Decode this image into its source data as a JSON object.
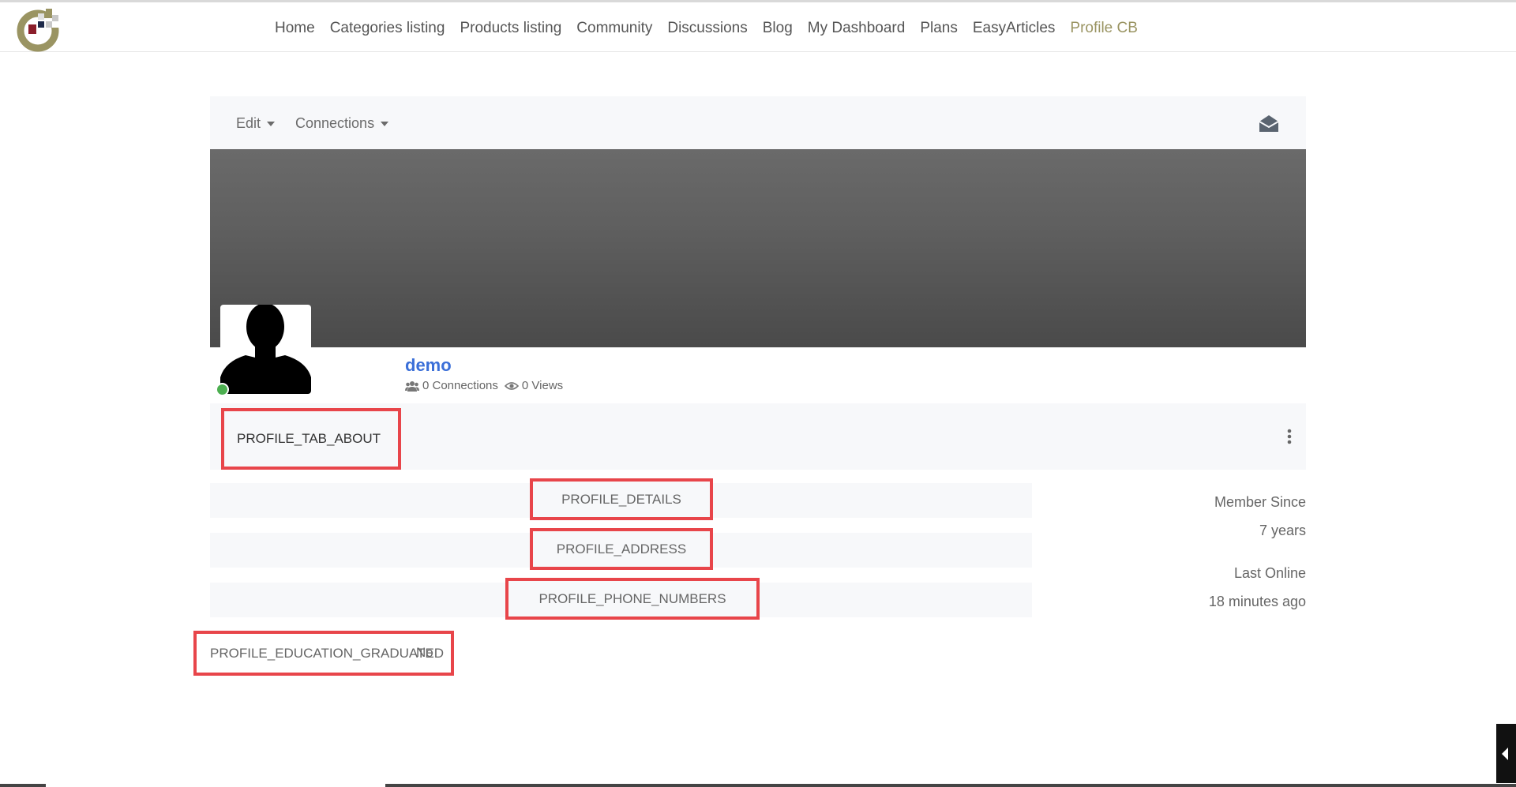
{
  "nav": {
    "items": [
      {
        "label": "Home"
      },
      {
        "label": "Categories listing"
      },
      {
        "label": "Products listing"
      },
      {
        "label": "Community"
      },
      {
        "label": "Discussions"
      },
      {
        "label": "Blog"
      },
      {
        "label": "My Dashboard"
      },
      {
        "label": "Plans"
      },
      {
        "label": "EasyArticles"
      },
      {
        "label": "Profile CB"
      }
    ],
    "active": "Profile CB",
    "active_color": "#9a9462"
  },
  "toolbar": {
    "edit_label": "Edit",
    "connections_label": "Connections"
  },
  "profile": {
    "username": "demo",
    "connections": "0 Connections",
    "views": "0 Views",
    "status_color": "#4caf50"
  },
  "tabs": {
    "about": "PROFILE_TAB_ABOUT"
  },
  "fields": {
    "details": "PROFILE_DETAILS",
    "address": "PROFILE_ADDRESS",
    "phone": "PROFILE_PHONE_NUMBERS",
    "education_label": "PROFILE_EDUCATION_GRADUATED",
    "education_value": "No"
  },
  "sidebar": {
    "member_since_label": "Member Since",
    "member_since_value": "7 years",
    "last_online_label": "Last Online",
    "last_online_value": "18 minutes ago"
  },
  "colors": {
    "highlight": "#e8454a",
    "link": "#3b6fd8"
  }
}
